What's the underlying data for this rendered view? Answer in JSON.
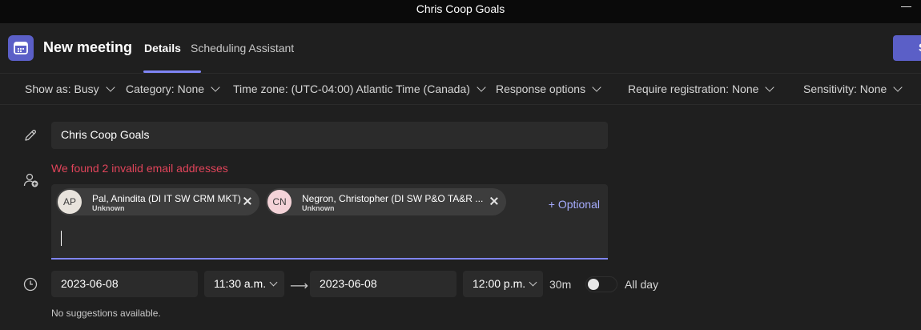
{
  "window": {
    "title": "Chris Coop Goals"
  },
  "header": {
    "page_title": "New meeting",
    "tabs": [
      {
        "label": "Details",
        "active": true
      },
      {
        "label": "Scheduling Assistant",
        "active": false
      }
    ],
    "send_label": "S"
  },
  "options": [
    {
      "label": "Show as: Busy"
    },
    {
      "label": "Category: None"
    },
    {
      "label": "Time zone: (UTC-04:00) Atlantic Time (Canada)"
    },
    {
      "label": "Response options"
    },
    {
      "label": "Require registration: None"
    },
    {
      "label": "Sensitivity: None"
    }
  ],
  "meeting": {
    "title": "Chris Coop Goals"
  },
  "attendees": {
    "error": "We found 2 invalid email addresses",
    "optional_label": "+ Optional",
    "people": [
      {
        "initials": "AP",
        "name": "Pal, Anindita (DI IT SW CRM MKT)",
        "status": "Unknown",
        "avatar_color": "#e8e3dc"
      },
      {
        "initials": "CN",
        "name": "Negron, Christopher (DI SW P&O TA&R ...",
        "status": "Unknown",
        "avatar_color": "#f4d3d8"
      }
    ]
  },
  "schedule": {
    "start_date": "2023-06-08",
    "start_time": "11:30 a.m.",
    "end_date": "2023-06-08",
    "end_time": "12:00 p.m.",
    "duration": "30m",
    "all_day_label": "All day",
    "all_day": false,
    "suggestions": "No suggestions available."
  },
  "colors": {
    "accent": "#5b5fc7",
    "error": "#e0445a",
    "link": "#a6acff"
  },
  "icons": [
    "calendar-icon",
    "pencil-icon",
    "add-person-icon",
    "clock-icon",
    "chevron-down-icon",
    "remove-icon",
    "arrow-right-icon"
  ]
}
